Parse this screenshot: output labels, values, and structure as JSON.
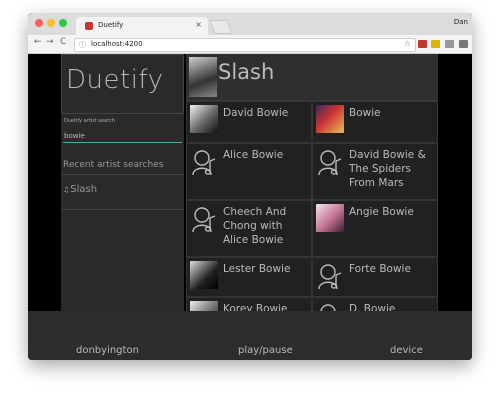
{
  "browser": {
    "tab_title": "Duetify",
    "tab_close": "×",
    "profile": "Dan",
    "url": "localhost:4200",
    "nav_back": "←",
    "nav_forward": "→",
    "nav_reload": "C",
    "info_icon": "ⓘ",
    "star_icon": "☆",
    "extension_colors": [
      "#c0392b",
      "#e0b400",
      "#999999",
      "#777777"
    ]
  },
  "sidebar": {
    "logo": "Duetify",
    "search_label": "Duetify artist search",
    "search_value": "bowie",
    "recent_title": "Recent artist searches",
    "recent_items": [
      {
        "label": "Slash",
        "icon": "artist-icon"
      }
    ]
  },
  "selected_artist": {
    "name": "Slash",
    "image": "artist-photo"
  },
  "results": [
    {
      "name": "David Bowie",
      "image": "photo"
    },
    {
      "name": "Bowie",
      "image": "photo"
    },
    {
      "name": "Alice Bowie",
      "image": "placeholder-icon"
    },
    {
      "name": "David Bowie & The Spiders From Mars",
      "image": "placeholder-icon"
    },
    {
      "name": "Cheech And Chong with Alice Bowie",
      "image": "placeholder-icon"
    },
    {
      "name": "Angie Bowie",
      "image": "photo"
    },
    {
      "name": "Lester Bowie",
      "image": "photo"
    },
    {
      "name": "Forte Bowie",
      "image": "placeholder-icon"
    },
    {
      "name": "Korey Bowie",
      "image": "photo"
    },
    {
      "name": "D. Bowie",
      "image": "placeholder-icon"
    }
  ],
  "status_bar": {
    "user": "donbyington",
    "playback": "play/pause",
    "device": "device"
  },
  "colors": {
    "window_dots": [
      "#ff5f57",
      "#febc2e",
      "#28c840"
    ],
    "accent_underline": "#44aaaa",
    "panel_background": "#2a2a2a"
  }
}
